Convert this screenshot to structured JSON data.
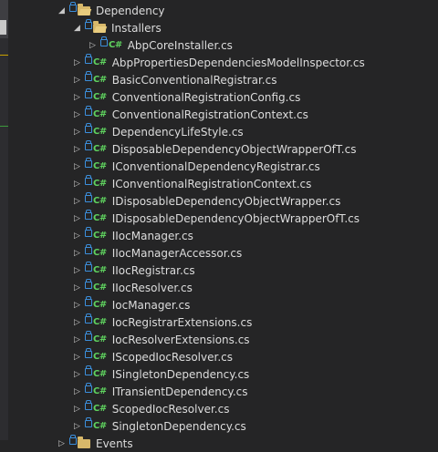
{
  "tree": {
    "dependency_folder": "Dependency",
    "installers_folder": "Installers",
    "installer_file": "AbpCoreInstaller.cs",
    "files": [
      "AbpPropertiesDependenciesModelInspector.cs",
      "BasicConventionalRegistrar.cs",
      "ConventionalRegistrationConfig.cs",
      "ConventionalRegistrationContext.cs",
      "DependencyLifeStyle.cs",
      "DisposableDependencyObjectWrapperOfT.cs",
      "IConventionalDependencyRegistrar.cs",
      "IConventionalRegistrationContext.cs",
      "IDisposableDependencyObjectWrapper.cs",
      "IDisposableDependencyObjectWrapperOfT.cs",
      "IIocManager.cs",
      "IIocManagerAccessor.cs",
      "IIocRegistrar.cs",
      "IIocResolver.cs",
      "IocManager.cs",
      "IocRegistrarExtensions.cs",
      "IocResolverExtensions.cs",
      "IScopedIocResolver.cs",
      "ISingletonDependency.cs",
      "ITransientDependency.cs",
      "ScopedIocResolver.cs",
      "SingletonDependency.cs"
    ],
    "cs_badge": "C#",
    "next_folder_partial": "Events"
  },
  "colors": {
    "background": "#252526",
    "text": "#dcdcdc",
    "cs_badge": "#5fd35f",
    "folder": "#d8b86a",
    "lock": "#3c8fdc"
  },
  "icons": {
    "expanded": "triangle-down",
    "collapsed": "triangle-right",
    "folder": "folder-icon",
    "lock": "lock-icon",
    "csharp": "csharp-file-icon"
  }
}
